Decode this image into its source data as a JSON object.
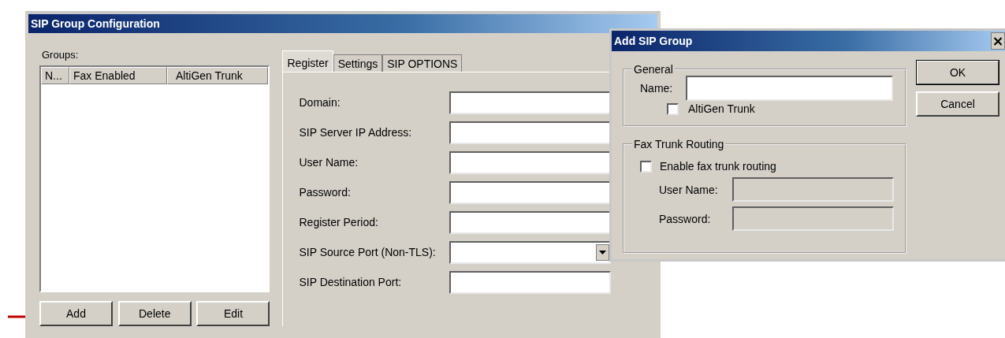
{
  "main_window": {
    "title": "SIP Group Configuration",
    "groups_label": "Groups:",
    "columns": [
      "N...",
      "Fax Enabled",
      "AltiGen Trunk"
    ],
    "buttons": [
      "Add",
      "Delete",
      "Edit"
    ],
    "tabs": [
      {
        "label": "Register",
        "selected": true
      },
      {
        "label": "Settings",
        "selected": false
      },
      {
        "label": "SIP OPTIONS",
        "selected": false
      }
    ],
    "fields": [
      {
        "label": "Domain:",
        "kind": "text"
      },
      {
        "label": "SIP Server IP Address:",
        "kind": "text"
      },
      {
        "label": "User Name:",
        "kind": "text"
      },
      {
        "label": "Password:",
        "kind": "text"
      },
      {
        "label": "Register Period:",
        "kind": "text"
      },
      {
        "label": "SIP Source Port (Non-TLS):",
        "kind": "dropdown"
      },
      {
        "label": "SIP Destination Port:",
        "kind": "text"
      }
    ]
  },
  "dialog": {
    "title": "Add SIP Group",
    "close": "×",
    "general": {
      "title": "General",
      "name_label": "Name:",
      "checkbox": {
        "label": "AltiGen Trunk",
        "checked": false
      }
    },
    "fax_routing": {
      "title": "Fax Trunk Routing",
      "checkbox": {
        "label": "Enable fax trunk routing",
        "checked": false
      },
      "fields": [
        {
          "label": "User Name:",
          "disabled": true
        },
        {
          "label": "Password:",
          "disabled": true
        }
      ]
    },
    "buttons": [
      {
        "label": "OK",
        "default": true
      },
      {
        "label": "Cancel",
        "default": false
      }
    ]
  }
}
